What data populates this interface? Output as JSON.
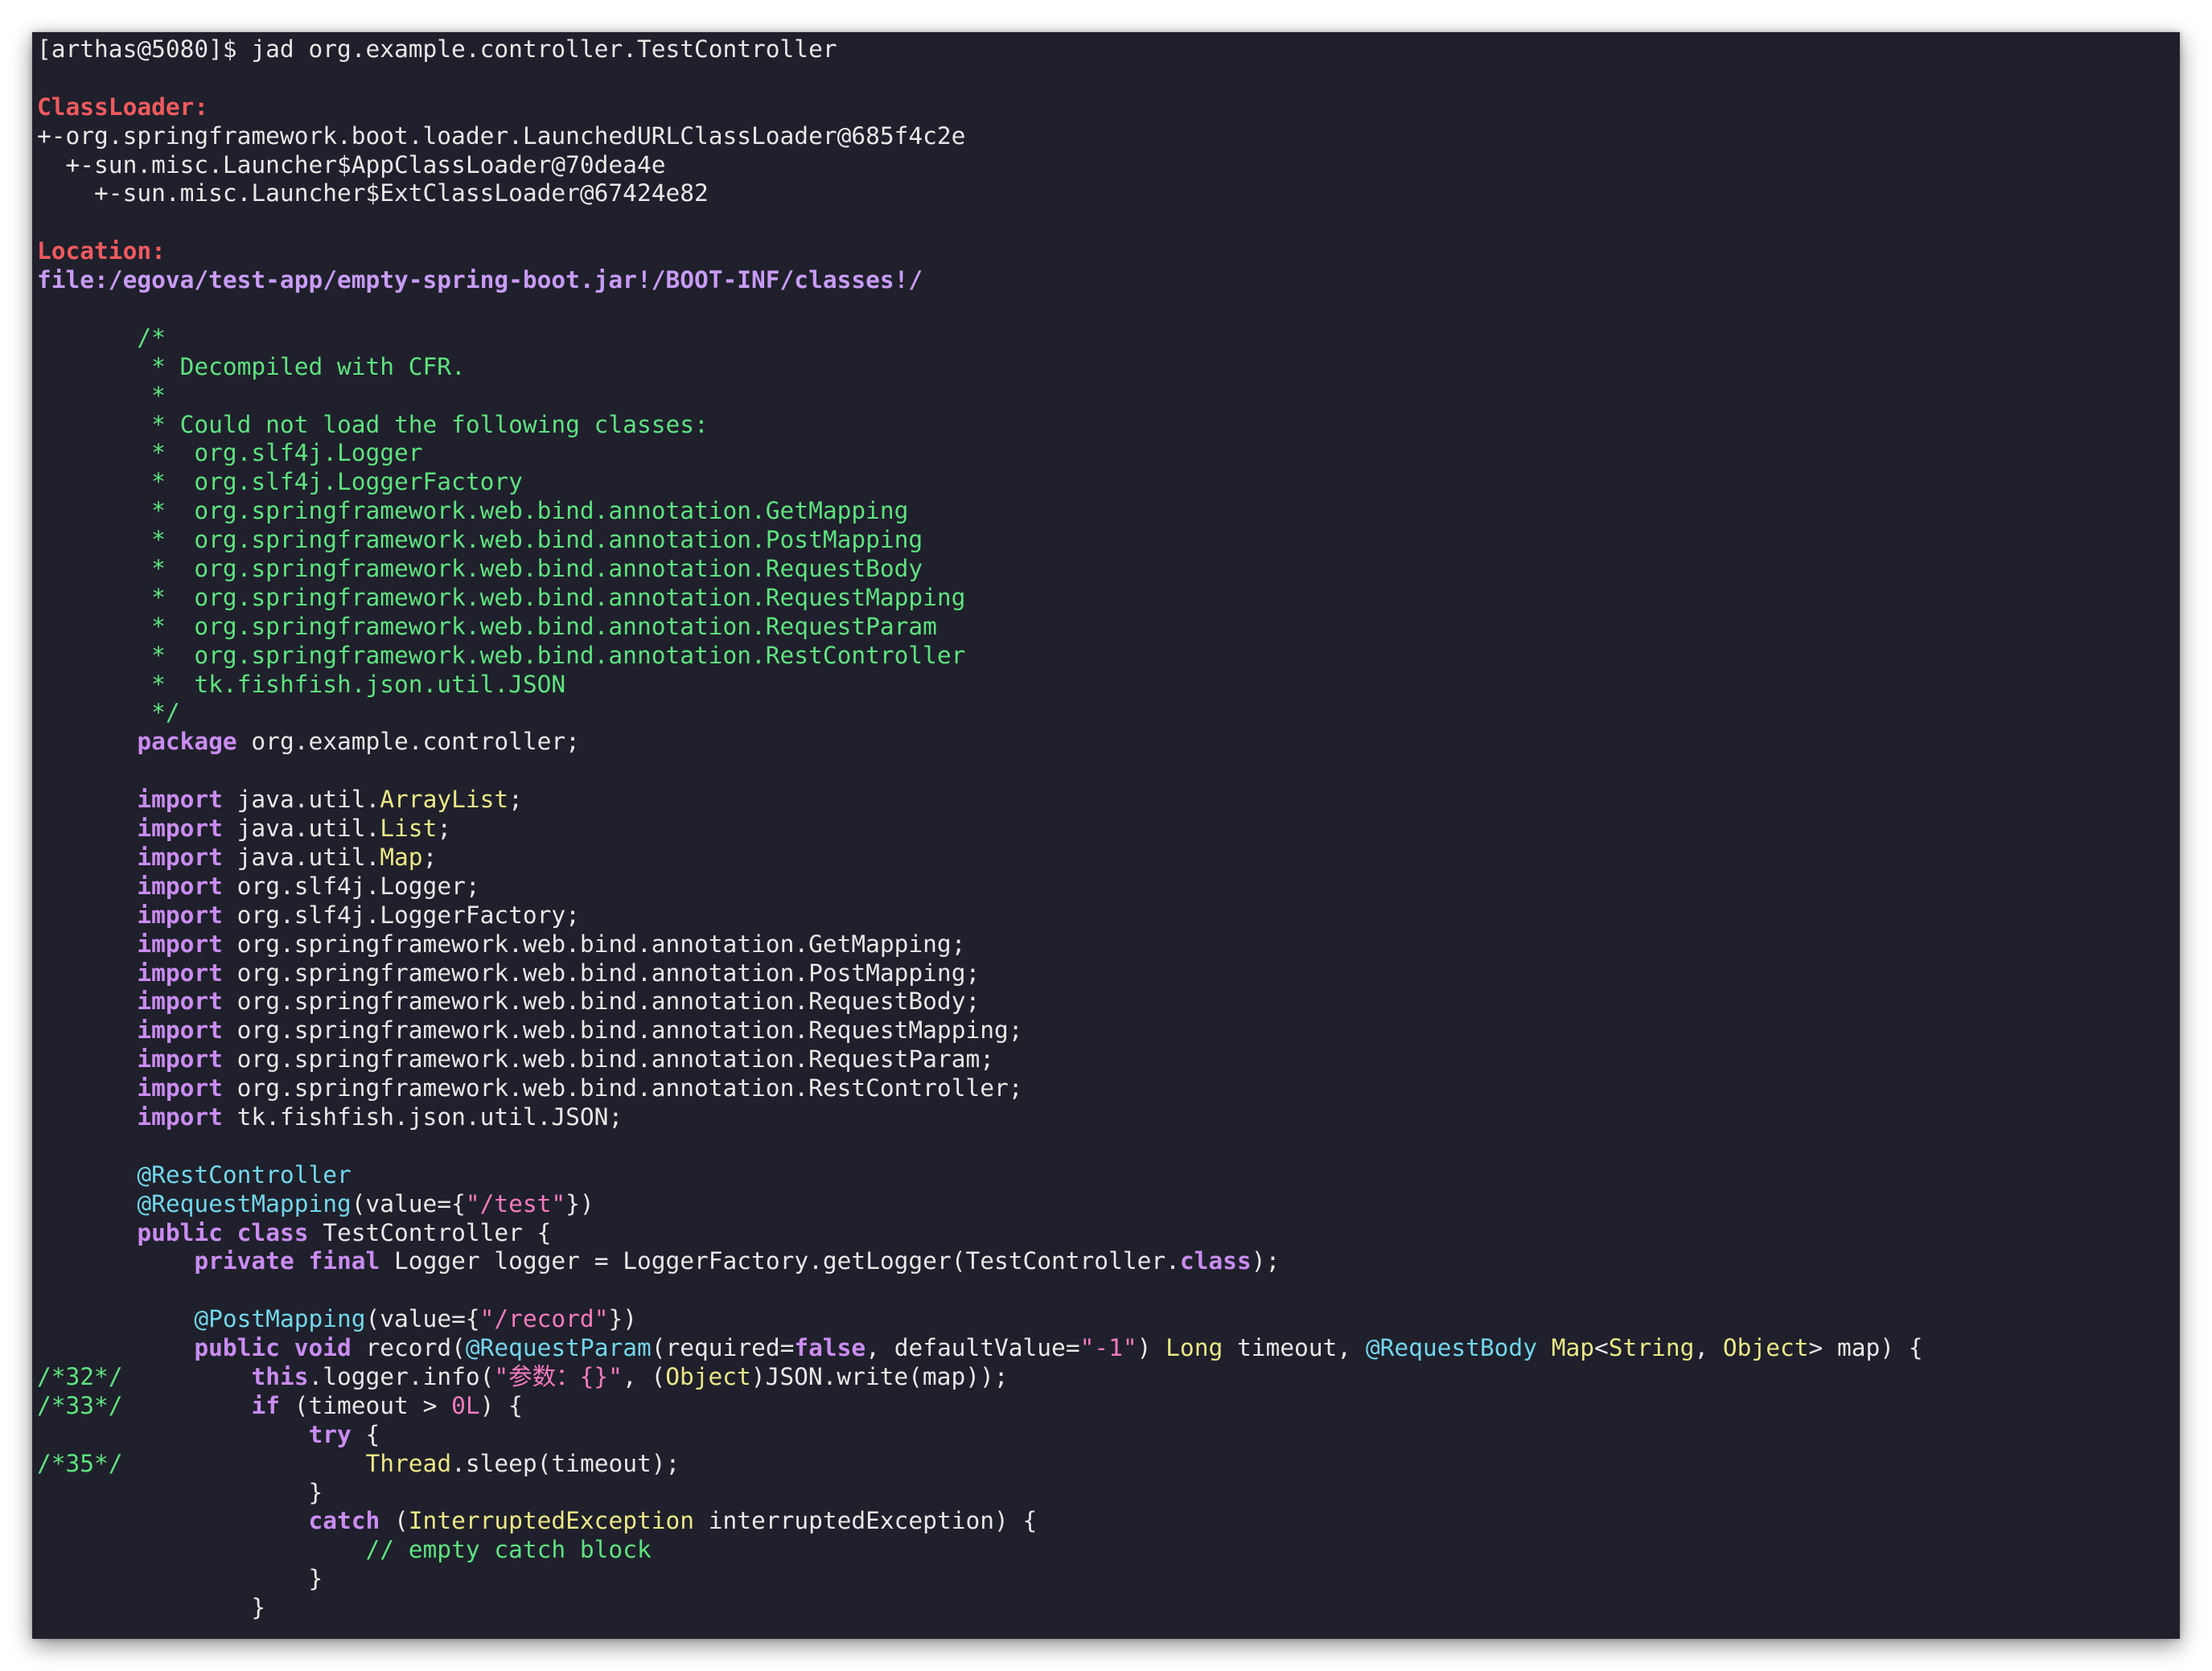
{
  "terminal": {
    "prompt": "[arthas@5080]$ ",
    "command": "jad org.example.controller.TestController"
  },
  "colors": {
    "background": "#1f202b",
    "text": "#e8e8e6",
    "label_red": "#ee5a5f",
    "path_purple": "#c89bf4",
    "comment_green": "#5ee280",
    "keyword_purple": "#c98cf0",
    "type_yellow": "#ece786",
    "annotation_cyan": "#72d6ec",
    "string_pink": "#f57ac0"
  },
  "lines": [
    [
      {
        "t": "[arthas@5080]$ jad org.example.controller.TestController",
        "c": "default"
      }
    ],
    [],
    [
      {
        "t": "ClassLoader:",
        "c": "red"
      }
    ],
    [
      {
        "t": "+-org.springframework.boot.loader.LaunchedURLClassLoader@685f4c2e",
        "c": "default"
      }
    ],
    [
      {
        "t": "  +-sun.misc.Launcher$AppClassLoader@70dea4e",
        "c": "default"
      }
    ],
    [
      {
        "t": "    +-sun.misc.Launcher$ExtClassLoader@67424e82",
        "c": "default"
      }
    ],
    [],
    [
      {
        "t": "Location:",
        "c": "red"
      }
    ],
    [
      {
        "t": "file:/egova/test-app/empty-spring-boot.jar!/BOOT-INF/classes!/",
        "c": "path"
      }
    ],
    [],
    [
      {
        "t": "       /*",
        "c": "comment"
      }
    ],
    [
      {
        "t": "        * Decompiled with CFR.",
        "c": "comment"
      }
    ],
    [
      {
        "t": "        *",
        "c": "comment"
      }
    ],
    [
      {
        "t": "        * Could not load the following classes:",
        "c": "comment"
      }
    ],
    [
      {
        "t": "        *  org.slf4j.Logger",
        "c": "comment"
      }
    ],
    [
      {
        "t": "        *  org.slf4j.LoggerFactory",
        "c": "comment"
      }
    ],
    [
      {
        "t": "        *  org.springframework.web.bind.annotation.GetMapping",
        "c": "comment"
      }
    ],
    [
      {
        "t": "        *  org.springframework.web.bind.annotation.PostMapping",
        "c": "comment"
      }
    ],
    [
      {
        "t": "        *  org.springframework.web.bind.annotation.RequestBody",
        "c": "comment"
      }
    ],
    [
      {
        "t": "        *  org.springframework.web.bind.annotation.RequestMapping",
        "c": "comment"
      }
    ],
    [
      {
        "t": "        *  org.springframework.web.bind.annotation.RequestParam",
        "c": "comment"
      }
    ],
    [
      {
        "t": "        *  org.springframework.web.bind.annotation.RestController",
        "c": "comment"
      }
    ],
    [
      {
        "t": "        *  tk.fishfish.json.util.JSON",
        "c": "comment"
      }
    ],
    [
      {
        "t": "        */",
        "c": "comment"
      }
    ],
    [
      {
        "t": "       ",
        "c": "default"
      },
      {
        "t": "package",
        "c": "keyword"
      },
      {
        "t": " org.example.controller;",
        "c": "default"
      }
    ],
    [],
    [
      {
        "t": "       ",
        "c": "default"
      },
      {
        "t": "import",
        "c": "keyword"
      },
      {
        "t": " java.util.",
        "c": "default"
      },
      {
        "t": "ArrayList",
        "c": "type"
      },
      {
        "t": ";",
        "c": "default"
      }
    ],
    [
      {
        "t": "       ",
        "c": "default"
      },
      {
        "t": "import",
        "c": "keyword"
      },
      {
        "t": " java.util.",
        "c": "default"
      },
      {
        "t": "List",
        "c": "type"
      },
      {
        "t": ";",
        "c": "default"
      }
    ],
    [
      {
        "t": "       ",
        "c": "default"
      },
      {
        "t": "import",
        "c": "keyword"
      },
      {
        "t": " java.util.",
        "c": "default"
      },
      {
        "t": "Map",
        "c": "type"
      },
      {
        "t": ";",
        "c": "default"
      }
    ],
    [
      {
        "t": "       ",
        "c": "default"
      },
      {
        "t": "import",
        "c": "keyword"
      },
      {
        "t": " org.slf4j.Logger;",
        "c": "default"
      }
    ],
    [
      {
        "t": "       ",
        "c": "default"
      },
      {
        "t": "import",
        "c": "keyword"
      },
      {
        "t": " org.slf4j.LoggerFactory;",
        "c": "default"
      }
    ],
    [
      {
        "t": "       ",
        "c": "default"
      },
      {
        "t": "import",
        "c": "keyword"
      },
      {
        "t": " org.springframework.web.bind.annotation.GetMapping;",
        "c": "default"
      }
    ],
    [
      {
        "t": "       ",
        "c": "default"
      },
      {
        "t": "import",
        "c": "keyword"
      },
      {
        "t": " org.springframework.web.bind.annotation.PostMapping;",
        "c": "default"
      }
    ],
    [
      {
        "t": "       ",
        "c": "default"
      },
      {
        "t": "import",
        "c": "keyword"
      },
      {
        "t": " org.springframework.web.bind.annotation.RequestBody;",
        "c": "default"
      }
    ],
    [
      {
        "t": "       ",
        "c": "default"
      },
      {
        "t": "import",
        "c": "keyword"
      },
      {
        "t": " org.springframework.web.bind.annotation.RequestMapping;",
        "c": "default"
      }
    ],
    [
      {
        "t": "       ",
        "c": "default"
      },
      {
        "t": "import",
        "c": "keyword"
      },
      {
        "t": " org.springframework.web.bind.annotation.RequestParam;",
        "c": "default"
      }
    ],
    [
      {
        "t": "       ",
        "c": "default"
      },
      {
        "t": "import",
        "c": "keyword"
      },
      {
        "t": " org.springframework.web.bind.annotation.RestController;",
        "c": "default"
      }
    ],
    [
      {
        "t": "       ",
        "c": "default"
      },
      {
        "t": "import",
        "c": "keyword"
      },
      {
        "t": " tk.fishfish.json.util.JSON;",
        "c": "default"
      }
    ],
    [],
    [
      {
        "t": "       ",
        "c": "default"
      },
      {
        "t": "@RestController",
        "c": "annotation"
      }
    ],
    [
      {
        "t": "       ",
        "c": "default"
      },
      {
        "t": "@RequestMapping",
        "c": "annotation"
      },
      {
        "t": "(value={",
        "c": "default"
      },
      {
        "t": "\"/test\"",
        "c": "string"
      },
      {
        "t": "})",
        "c": "default"
      }
    ],
    [
      {
        "t": "       ",
        "c": "default"
      },
      {
        "t": "public",
        "c": "keyword"
      },
      {
        "t": " ",
        "c": "default"
      },
      {
        "t": "class",
        "c": "keyword"
      },
      {
        "t": " TestController {",
        "c": "default"
      }
    ],
    [
      {
        "t": "           ",
        "c": "default"
      },
      {
        "t": "private",
        "c": "keyword"
      },
      {
        "t": " ",
        "c": "default"
      },
      {
        "t": "final",
        "c": "keyword"
      },
      {
        "t": " Logger logger = LoggerFactory.getLogger(TestController.",
        "c": "default"
      },
      {
        "t": "class",
        "c": "keyword"
      },
      {
        "t": ");",
        "c": "default"
      }
    ],
    [],
    [
      {
        "t": "           ",
        "c": "default"
      },
      {
        "t": "@PostMapping",
        "c": "annotation"
      },
      {
        "t": "(value={",
        "c": "default"
      },
      {
        "t": "\"/record\"",
        "c": "string"
      },
      {
        "t": "})",
        "c": "default"
      }
    ],
    [
      {
        "t": "           ",
        "c": "default"
      },
      {
        "t": "public",
        "c": "keyword"
      },
      {
        "t": " ",
        "c": "default"
      },
      {
        "t": "void",
        "c": "keyword"
      },
      {
        "t": " record(",
        "c": "default"
      },
      {
        "t": "@RequestParam",
        "c": "annotation"
      },
      {
        "t": "(required=",
        "c": "default"
      },
      {
        "t": "false",
        "c": "keyword"
      },
      {
        "t": ", defaultValue=",
        "c": "default"
      },
      {
        "t": "\"-1\"",
        "c": "string"
      },
      {
        "t": ") ",
        "c": "default"
      },
      {
        "t": "Long",
        "c": "type"
      },
      {
        "t": " timeout, ",
        "c": "default"
      },
      {
        "t": "@RequestBody",
        "c": "annotation"
      },
      {
        "t": " ",
        "c": "default"
      },
      {
        "t": "Map",
        "c": "type"
      },
      {
        "t": "<",
        "c": "default"
      },
      {
        "t": "String",
        "c": "type"
      },
      {
        "t": ", ",
        "c": "default"
      },
      {
        "t": "Object",
        "c": "type"
      },
      {
        "t": "> map) {",
        "c": "default"
      }
    ],
    [
      {
        "t": "/*32*/",
        "c": "linenum"
      },
      {
        "t": "         ",
        "c": "default"
      },
      {
        "t": "this",
        "c": "keyword"
      },
      {
        "t": ".logger.info(",
        "c": "default"
      },
      {
        "t": "\"参数：{}\"",
        "c": "string"
      },
      {
        "t": ", (",
        "c": "default"
      },
      {
        "t": "Object",
        "c": "type"
      },
      {
        "t": ")JSON.write(map));",
        "c": "default"
      }
    ],
    [
      {
        "t": "/*33*/",
        "c": "linenum"
      },
      {
        "t": "         ",
        "c": "default"
      },
      {
        "t": "if",
        "c": "keyword"
      },
      {
        "t": " (timeout > ",
        "c": "default"
      },
      {
        "t": "0L",
        "c": "number"
      },
      {
        "t": ") {",
        "c": "default"
      }
    ],
    [
      {
        "t": "                   ",
        "c": "default"
      },
      {
        "t": "try",
        "c": "keyword"
      },
      {
        "t": " {",
        "c": "default"
      }
    ],
    [
      {
        "t": "/*35*/",
        "c": "linenum"
      },
      {
        "t": "                 ",
        "c": "default"
      },
      {
        "t": "Thread",
        "c": "type"
      },
      {
        "t": ".sleep(timeout);",
        "c": "default"
      }
    ],
    [
      {
        "t": "                   }",
        "c": "default"
      }
    ],
    [
      {
        "t": "                   ",
        "c": "default"
      },
      {
        "t": "catch",
        "c": "keyword"
      },
      {
        "t": " (",
        "c": "default"
      },
      {
        "t": "InterruptedException",
        "c": "type"
      },
      {
        "t": " interruptedException) {",
        "c": "default"
      }
    ],
    [
      {
        "t": "                       ",
        "c": "default"
      },
      {
        "t": "// empty catch block",
        "c": "comment"
      }
    ],
    [
      {
        "t": "                   }",
        "c": "default"
      }
    ],
    [
      {
        "t": "               }",
        "c": "default"
      }
    ]
  ]
}
